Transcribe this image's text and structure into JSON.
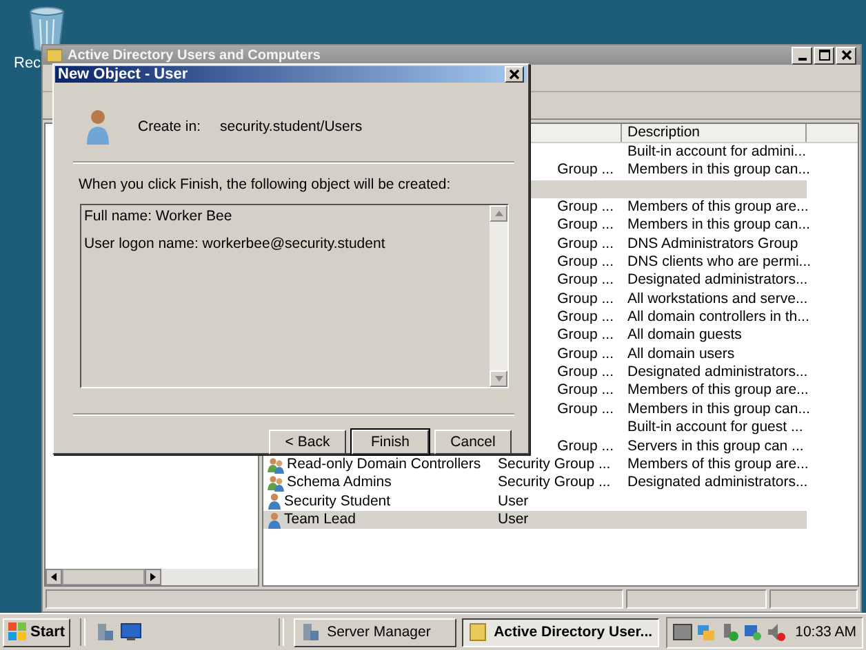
{
  "desktop": {
    "icon_label": "Rec"
  },
  "main_window": {
    "title": "Active Directory Users and Computers",
    "list": {
      "columns": [
        "Description"
      ],
      "rows": [
        {
          "description": "Built-in account for admini...",
          "selected": false
        },
        {
          "type": "Group ...",
          "description": "Members in this group can...",
          "selected": false
        },
        {
          "selected": true
        },
        {
          "type": "Group ...",
          "description": "Members of this group are...",
          "selected": false
        },
        {
          "type": "Group ...",
          "description": "Members in this group can...",
          "selected": false
        },
        {
          "type": "Group ...",
          "description": "DNS Administrators Group",
          "selected": false
        },
        {
          "type": "Group ...",
          "description": "DNS clients who are permi...",
          "selected": false
        },
        {
          "type": "Group ...",
          "description": "Designated administrators...",
          "selected": false
        },
        {
          "type": "Group ...",
          "description": "All workstations and serve...",
          "selected": false
        },
        {
          "type": "Group ...",
          "description": "All domain controllers in th...",
          "selected": false
        },
        {
          "type": "Group ...",
          "description": "All domain guests",
          "selected": false
        },
        {
          "type": "Group ...",
          "description": "All domain users",
          "selected": false
        },
        {
          "type": "Group ...",
          "description": "Designated administrators...",
          "selected": false
        },
        {
          "type": "Group ...",
          "description": "Members of this group are...",
          "selected": false
        },
        {
          "type": "Group ...",
          "description": "Members in this group can...",
          "selected": false
        },
        {
          "description": "Built-in account for guest ...",
          "selected": false
        },
        {
          "type": "Group ...",
          "description": "Servers in this group can ...",
          "selected": false
        },
        {
          "kind": "group",
          "name": "Read-only Domain Controllers",
          "type": "Security Group ...",
          "description": "Members of this group are...",
          "selected": false
        },
        {
          "kind": "group",
          "name": "Schema Admins",
          "type": "Security Group ...",
          "description": "Designated administrators...",
          "selected": false
        },
        {
          "kind": "user",
          "name": "Security Student",
          "type": "User",
          "selected": false
        },
        {
          "kind": "user",
          "name": "Team Lead",
          "type": "User",
          "selected": true
        }
      ]
    }
  },
  "dialog": {
    "title": "New Object - User",
    "create_in_label": "Create in:",
    "create_in_value": "security.student/Users",
    "intro": "When you click Finish, the following object will be created:",
    "summary_lines": [
      "Full name: Worker Bee",
      "User logon name: workerbee@security.student"
    ],
    "buttons": [
      {
        "label": "< Back",
        "default": false
      },
      {
        "label": "Finish",
        "default": true
      },
      {
        "label": "Cancel",
        "default": false
      }
    ]
  },
  "taskbar": {
    "start": "Start",
    "tasks": [
      {
        "label": "Server Manager",
        "selected": false
      },
      {
        "label": "Active Directory User...",
        "selected": true
      }
    ],
    "clock": "10:33 AM"
  }
}
